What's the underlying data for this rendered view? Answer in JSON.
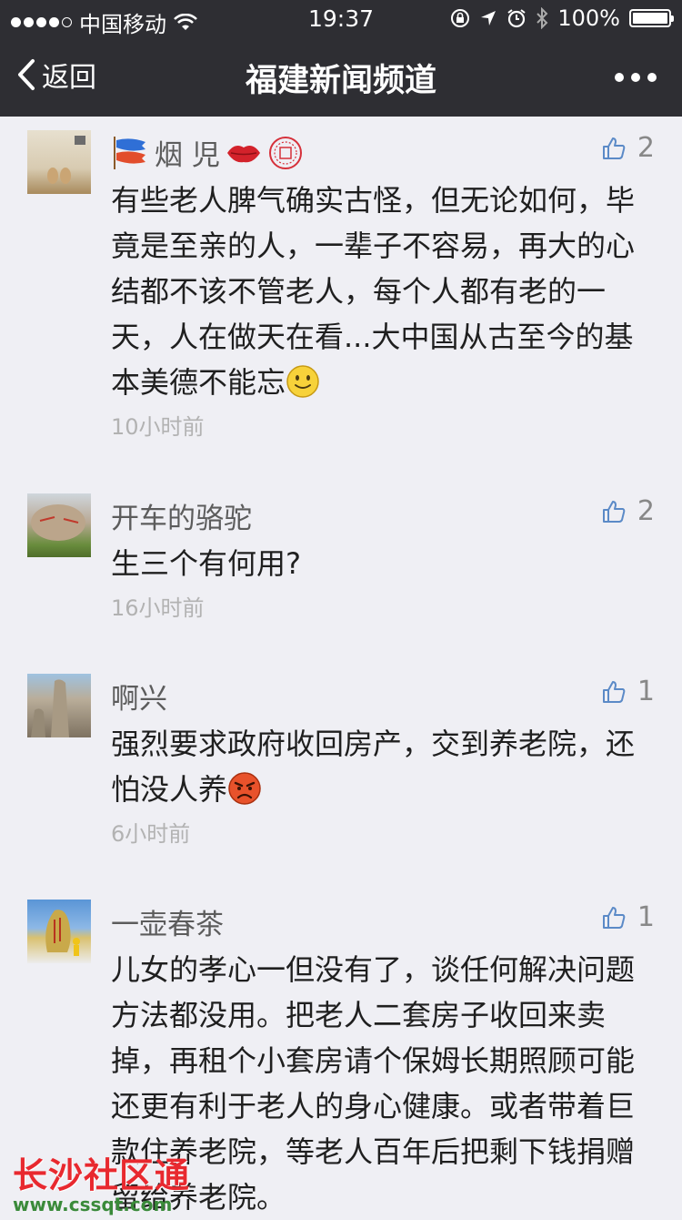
{
  "status_bar": {
    "carrier": "中国移动",
    "time": "19:37",
    "battery": "100%"
  },
  "nav": {
    "back_label": "返回",
    "title": "福建新闻频道"
  },
  "comments": [
    {
      "name": "烟 児",
      "text": "有些老人脾气确实古怪，但无论如何，毕竟是至亲的人，一辈子不容易，再大的心结都不该不管老人，每个人都有老的一天，人在做天在看...大中国从古至今的基本美德不能忘",
      "emoji": "smile-emoji",
      "time": "10小时前",
      "likes": "2"
    },
    {
      "name": "开车的骆驼",
      "text": "生三个有何用?",
      "time": "16小时前",
      "likes": "2"
    },
    {
      "name": "啊兴",
      "text": "强烈要求政府收回房产，交到养老院，还怕没人养",
      "emoji": "angry-emoji",
      "time": "6小时前",
      "likes": "1"
    },
    {
      "name": "一壶春茶",
      "text": "儿女的孝心一但没有了，谈任何解决问题方法都没用。把老人二套房子收回来卖掉，再租个小套房请个保姆长期照顾可能还更有利于老人的身心健康。或者带着巨款住养老院，等老人百年后把剩下钱捐赠留给养老院。",
      "likes": "1"
    }
  ],
  "watermark": {
    "name": "长沙社区通",
    "url": "www.cssqt.com"
  }
}
